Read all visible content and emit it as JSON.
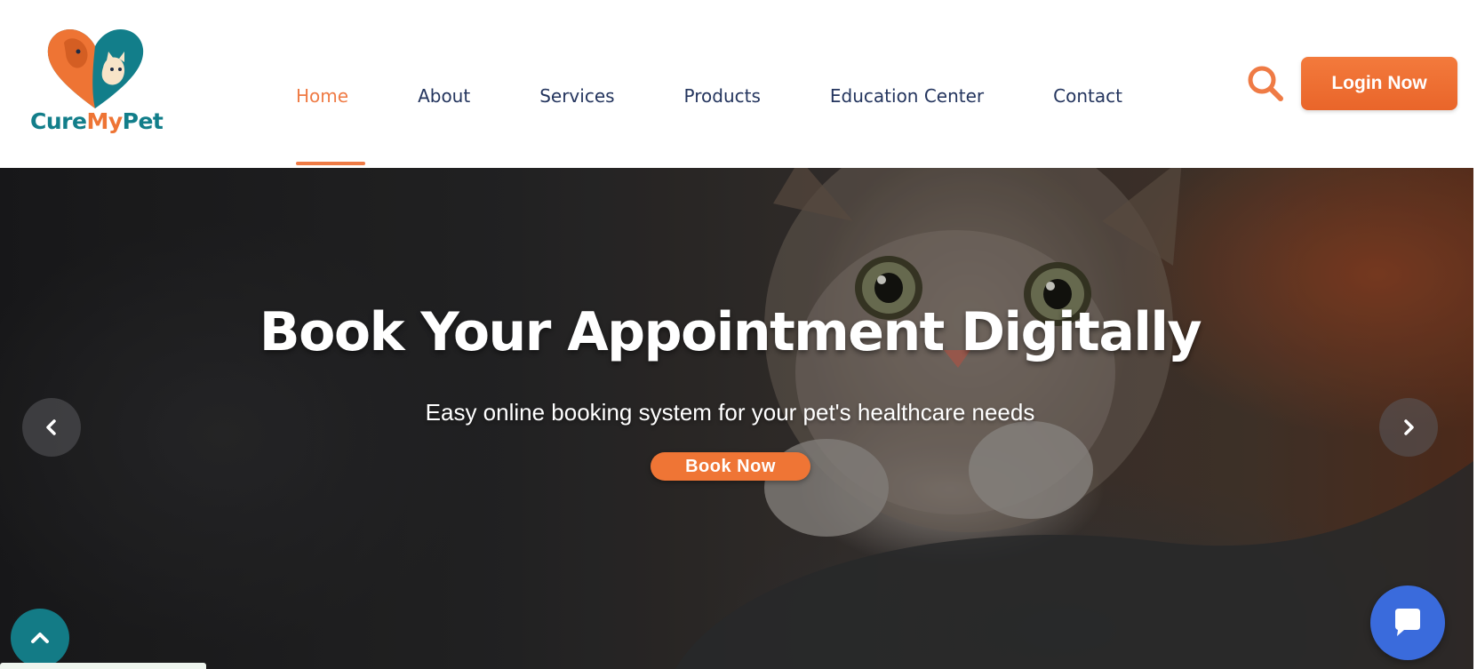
{
  "brand": {
    "name_part1": "Cure",
    "name_part2": "My",
    "name_part3": "Pet",
    "primary_color": "#ef7b45",
    "secondary_color": "#127e8a"
  },
  "nav": {
    "items": [
      {
        "label": "Home",
        "active": true
      },
      {
        "label": "About",
        "active": false
      },
      {
        "label": "Services",
        "active": false
      },
      {
        "label": "Products",
        "active": false
      },
      {
        "label": "Education Center",
        "active": false
      },
      {
        "label": "Contact",
        "active": false
      }
    ]
  },
  "header": {
    "search_icon": "search-icon",
    "login_label": "Login Now"
  },
  "hero": {
    "title": "Book Your Appointment Digitally",
    "subtitle": "Easy online booking system for your pet's healthcare needs",
    "cta_label": "Book Now",
    "prev_icon": "chevron-left-icon",
    "next_icon": "chevron-right-icon"
  },
  "floating": {
    "scroll_top_icon": "chevron-up-icon",
    "chat_icon": "chat-bubble-icon",
    "chat_color": "#3a6bdc",
    "scroll_color": "#137b86"
  }
}
